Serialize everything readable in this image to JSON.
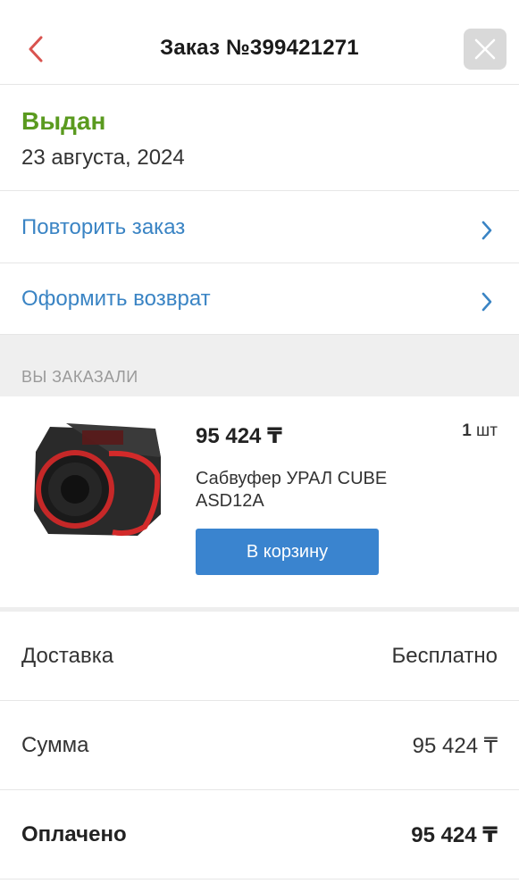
{
  "header": {
    "title": "Заказ №399421271",
    "back_icon": "chevron-left-icon",
    "close_icon": "close-icon",
    "accent_color": "#d9534f"
  },
  "status": {
    "label": "Выдан",
    "date": "23 августа, 2024",
    "color": "#5a9a1f"
  },
  "actions": [
    {
      "label": "Повторить заказ",
      "icon": "chevron-right-icon"
    },
    {
      "label": "Оформить возврат",
      "icon": "chevron-right-icon"
    }
  ],
  "section": {
    "caption": "ВЫ ЗАКАЗАЛИ"
  },
  "product": {
    "price": "95 424 ₸",
    "qty_number": "1",
    "qty_unit": "шт",
    "name": "Сабвуфер УРАЛ CUBE ASD12A",
    "cart_button": "В корзину",
    "image": "subwoofer-image"
  },
  "summary": [
    {
      "key": "Доставка",
      "value": "Бесплатно"
    },
    {
      "key": "Сумма",
      "value": "95 424 ₸"
    },
    {
      "key": "Оплачено",
      "value": "95 424 ₸"
    }
  ],
  "colors": {
    "link": "#3a84c4",
    "button": "#3a84cf"
  }
}
